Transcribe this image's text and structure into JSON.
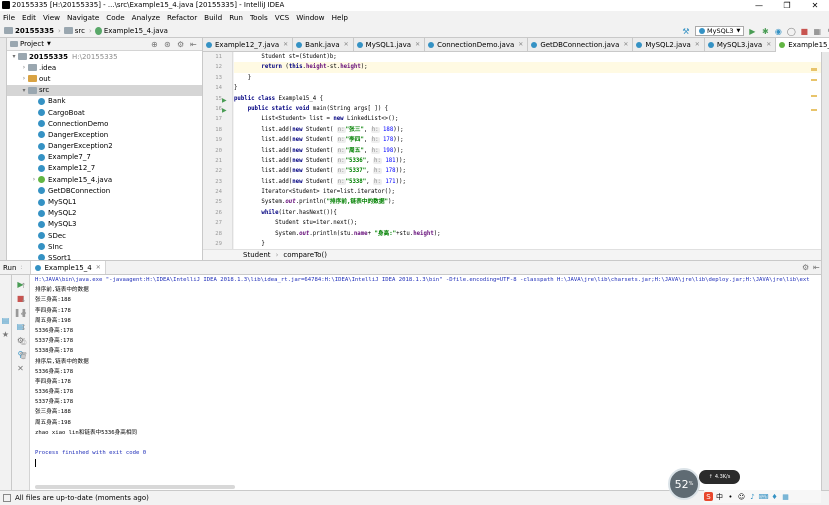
{
  "window": {
    "title": "20155335 [H:\\20155335] - ...\\src\\Example15_4.java [20155335] - IntelliJ IDEA"
  },
  "menu": [
    "File",
    "Edit",
    "View",
    "Navigate",
    "Code",
    "Analyze",
    "Refactor",
    "Build",
    "Run",
    "Tools",
    "VCS",
    "Window",
    "Help"
  ],
  "nav": {
    "project": "20155335",
    "src": "src",
    "file": "Example15_4.java",
    "run_config": "MySQL3"
  },
  "project_panel": {
    "title": "Project",
    "items": [
      {
        "label": "20155335",
        "extra": "H:\\20155335",
        "type": "folder",
        "indent": 0,
        "expanded": true
      },
      {
        "label": ".idea",
        "type": "folder",
        "indent": 1,
        "expanded": false
      },
      {
        "label": "out",
        "type": "folder-o",
        "indent": 1,
        "expanded": false
      },
      {
        "label": "src",
        "type": "folder",
        "indent": 1,
        "expanded": true,
        "selected": true
      },
      {
        "label": "Bank",
        "type": "class",
        "indent": 2
      },
      {
        "label": "CargoBoat",
        "type": "class",
        "indent": 2
      },
      {
        "label": "ConnectionDemo",
        "type": "class",
        "indent": 2
      },
      {
        "label": "DangerException",
        "type": "class",
        "indent": 2
      },
      {
        "label": "DangerException2",
        "type": "class",
        "indent": 2
      },
      {
        "label": "Example7_7",
        "type": "class",
        "indent": 2
      },
      {
        "label": "Example12_7",
        "type": "class",
        "indent": 2
      },
      {
        "label": "Example15_4.java",
        "type": "class-g",
        "indent": 2,
        "expanded": false
      },
      {
        "label": "GetDBConnection",
        "type": "class",
        "indent": 2
      },
      {
        "label": "MySQL1",
        "type": "class",
        "indent": 2
      },
      {
        "label": "MySQL2",
        "type": "class",
        "indent": 2
      },
      {
        "label": "MySQL3",
        "type": "class",
        "indent": 2
      },
      {
        "label": "SDec",
        "type": "class",
        "indent": 2
      },
      {
        "label": "SInc",
        "type": "class",
        "indent": 2
      },
      {
        "label": "SSort1",
        "type": "class",
        "indent": 2
      }
    ]
  },
  "tabs": [
    "Example12_7.java",
    "Bank.java",
    "MySQL1.java",
    "ConnectionDemo.java",
    "GetDBConnection.java",
    "MySQL2.java",
    "MySQL3.java",
    "Example15_4.java"
  ],
  "active_tab": 7,
  "editor": {
    "line_numbers": [
      "11",
      "12",
      "13",
      "14",
      "15",
      "16",
      "17",
      "18",
      "19",
      "20",
      "21",
      "22",
      "23",
      "24",
      "25",
      "26",
      "27",
      "28",
      "29"
    ],
    "breadcrumb": [
      "Student",
      "compareTo()"
    ]
  },
  "run": {
    "label": "Run",
    "tab": "Example15_4",
    "command": "H:\\JAVA\\bin\\java.exe \"-javaagent:H:\\IDEA\\IntelliJ IDEA 2018.1.3\\lib\\idea_rt.jar=64784:H:\\IDEA\\IntelliJ IDEA 2018.1.3\\bin\" -Dfile.encoding=UTF-8 -classpath H:\\JAVA\\jre\\lib\\charsets.jar;H:\\JAVA\\jre\\lib\\deploy.jar;H:\\JAVA\\jre\\lib\\ext",
    "output": [
      "排序前,链表中的数据",
      "张三身高:188",
      "李四身高:178",
      "周五身高:198",
      "5336身高:178",
      "5337身高:178",
      "5338身高:178",
      "排序后,链表中的数据",
      "5336身高:178",
      "李四身高:178",
      "5336身高:178",
      "5337身高:178",
      "张三身高:188",
      "周五身高:198",
      "zhao xiao lin和链表中5336身高相同"
    ],
    "finish": "Process finished with exit code 0"
  },
  "status": {
    "text": "All files are up-to-date (moments ago)"
  },
  "widget": {
    "value": "52",
    "unit": "%",
    "speed": "4.3K/s"
  }
}
